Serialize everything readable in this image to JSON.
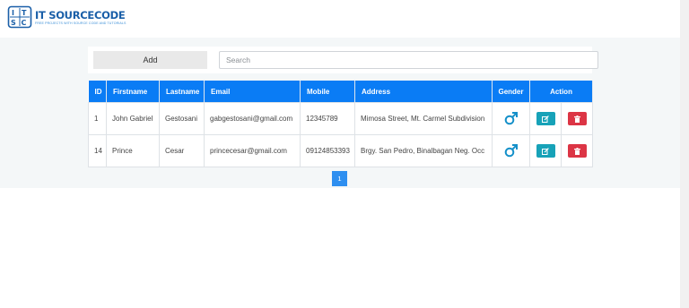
{
  "brand": {
    "name": "IT SOURCECODE",
    "tagline": "FREE PROJECTS WITH SOURCE CODE AND TUTORIALS"
  },
  "toolbar": {
    "add_label": "Add",
    "search_placeholder": "Search"
  },
  "table": {
    "headers": {
      "id": "ID",
      "firstname": "Firstname",
      "lastname": "Lastname",
      "email": "Email",
      "mobile": "Mobile",
      "address": "Address",
      "gender": "Gender",
      "action": "Action"
    },
    "rows": [
      {
        "id": "1",
        "firstname": "John Gabriel",
        "lastname": "Gestosani",
        "email": "gabgestosani@gmail.com",
        "mobile": "12345789",
        "address": "Mimosa Street, Mt. Carmel Subdivision",
        "gender_icon": "male-icon"
      },
      {
        "id": "14",
        "firstname": "Prince",
        "lastname": "Cesar",
        "email": "princecesar@gmail.com",
        "mobile": "09124853393",
        "address": "Brgy. San Pedro, Binalbagan Neg. Occ",
        "gender_icon": "male-icon"
      }
    ]
  },
  "pagination": {
    "current": "1"
  },
  "colors": {
    "header": "#0a7cf5",
    "edit": "#17a2b8",
    "delete": "#dc3545",
    "gender": "#1590c9"
  }
}
